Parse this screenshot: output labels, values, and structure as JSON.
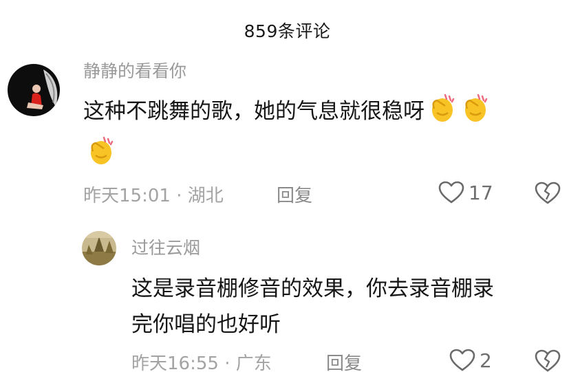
{
  "header": {
    "title": "859条评论"
  },
  "comments": [
    {
      "author": "静静的看看你",
      "text_line1": "这种不跳舞的歌，她的气息就很稳呀",
      "emoji_icon": "clapping-hands",
      "emoji_count": 3,
      "time_location": "昨天15:01 · 湖北",
      "reply_label": "回复",
      "likes": "17",
      "reply": {
        "author": "过往云烟",
        "text_line1": "这是录音棚修音的效果，你去录音棚录",
        "text_line2": "完你唱的也好听",
        "time_location": "昨天16:55 · 广东",
        "reply_label": "回复",
        "likes": "2"
      }
    }
  ],
  "colors": {
    "meta_gray": "#a3a3a3",
    "author_gray": "#9a9a9a",
    "text": "#161616",
    "emoji_yellow": "#f7c325"
  }
}
